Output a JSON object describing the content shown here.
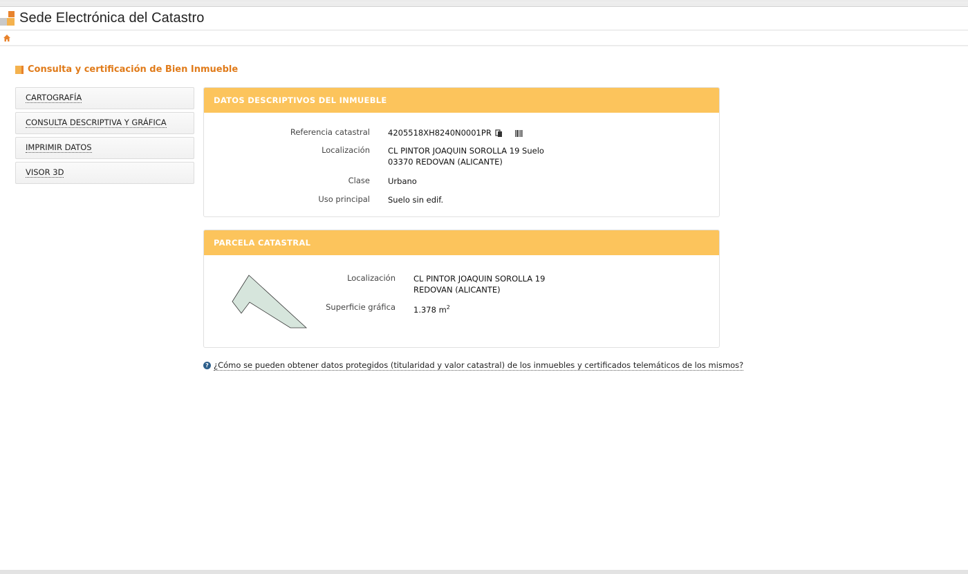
{
  "header": {
    "title": "Sede Electrónica del Catastro"
  },
  "page": {
    "heading": "Consulta y certificación de Bien Inmueble"
  },
  "menu": {
    "items": [
      {
        "label": "CARTOGRAFÍA"
      },
      {
        "label": "CONSULTA DESCRIPTIVA Y GRÁFICA"
      },
      {
        "label": "IMPRIMIR DATOS"
      },
      {
        "label": "VISOR 3D"
      }
    ]
  },
  "descriptive": {
    "title": "DATOS DESCRIPTIVOS DEL INMUEBLE",
    "ref_label": "Referencia catastral",
    "ref_value": "4205518XH8240N0001PR",
    "loc_label": "Localización",
    "loc_line1": "CL PINTOR JOAQUIN SOROLLA 19 Suelo",
    "loc_line2": "03370 REDOVAN (ALICANTE)",
    "class_label": "Clase",
    "class_value": "Urbano",
    "use_label": "Uso principal",
    "use_value": "Suelo sin edif."
  },
  "parcel": {
    "title": "PARCELA CATASTRAL",
    "loc_label": "Localización",
    "loc_line1": "CL PINTOR JOAQUIN SOROLLA 19",
    "loc_line2": "REDOVAN (ALICANTE)",
    "area_label": "Superficie gráfica",
    "area_value": "1.378 m",
    "area_unit_sup": "2",
    "shape_fill": "#d6e5dc"
  },
  "help": {
    "text": "¿Cómo se pueden obtener datos protegidos (titularidad y valor catastral) de los inmuebles y certificados telemáticos de los mismos?"
  },
  "colors": {
    "accent_orange": "#e07b1a",
    "panel_header": "#fcc45c"
  }
}
